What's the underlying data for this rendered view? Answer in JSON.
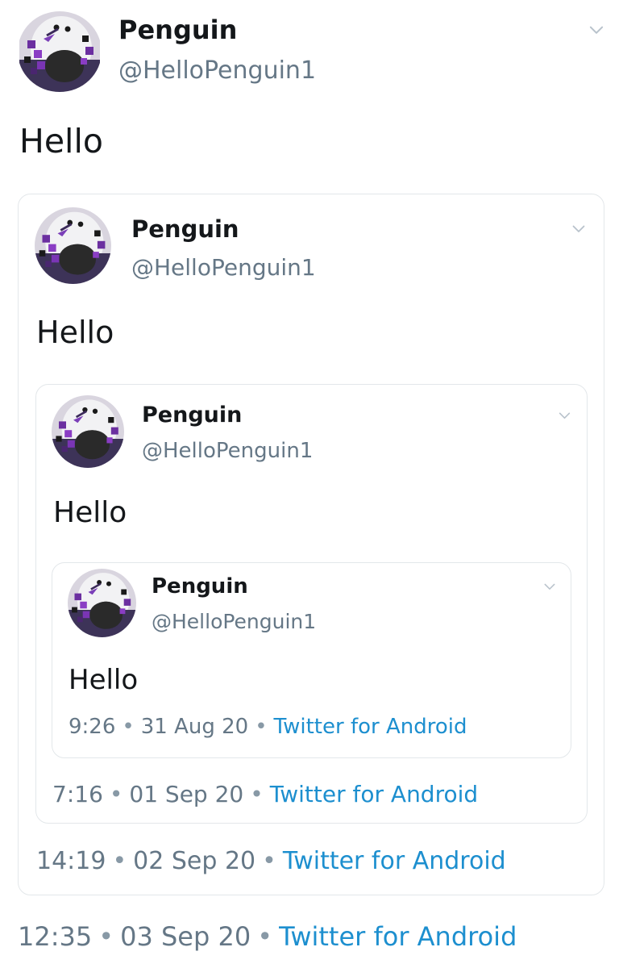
{
  "tweets": [
    {
      "name": "Penguin",
      "handle": "@HelloPenguin1",
      "text": "Hello",
      "time": "12:35",
      "date": "03 Sep 20",
      "source": "Twitter for Android"
    },
    {
      "name": "Penguin",
      "handle": "@HelloPenguin1",
      "text": "Hello",
      "time": "14:19",
      "date": "02 Sep 20",
      "source": "Twitter for Android"
    },
    {
      "name": "Penguin",
      "handle": "@HelloPenguin1",
      "text": "Hello",
      "time": "7:16",
      "date": "01 Sep 20",
      "source": "Twitter for Android"
    },
    {
      "name": "Penguin",
      "handle": "@HelloPenguin1",
      "text": "Hello",
      "time": "9:26",
      "date": "31 Aug 20",
      "source": "Twitter for Android"
    }
  ],
  "separator": "•",
  "icons": {
    "menu": "chevron-down-icon",
    "avatar": "penguin-avatar"
  },
  "colors": {
    "link": "#1d8fcf",
    "secondary": "#657786",
    "border": "#e3e7ea",
    "text": "#14171a"
  }
}
